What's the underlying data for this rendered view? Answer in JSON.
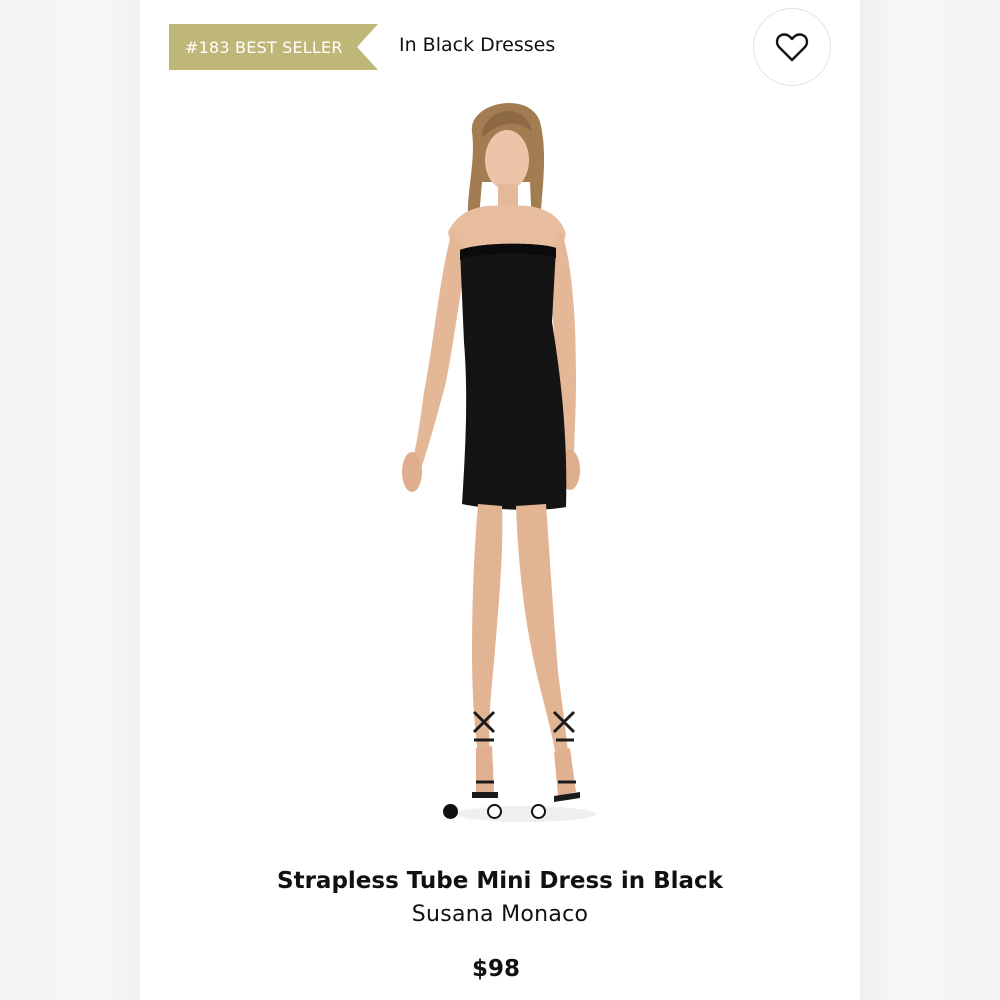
{
  "badge": {
    "label": "#183 BEST SELLER",
    "color": "#bfb778"
  },
  "category": {
    "label": "In Black Dresses"
  },
  "favorite": {
    "icon": "heart-outline-icon"
  },
  "gallery": {
    "image_alt": "Model wearing strapless tube mini dress in black",
    "dots": [
      {
        "active": true
      },
      {
        "active": false
      },
      {
        "active": false
      }
    ]
  },
  "product": {
    "name": "Strapless Tube Mini Dress in Black",
    "brand": "Susana Monaco",
    "price": "$98"
  }
}
